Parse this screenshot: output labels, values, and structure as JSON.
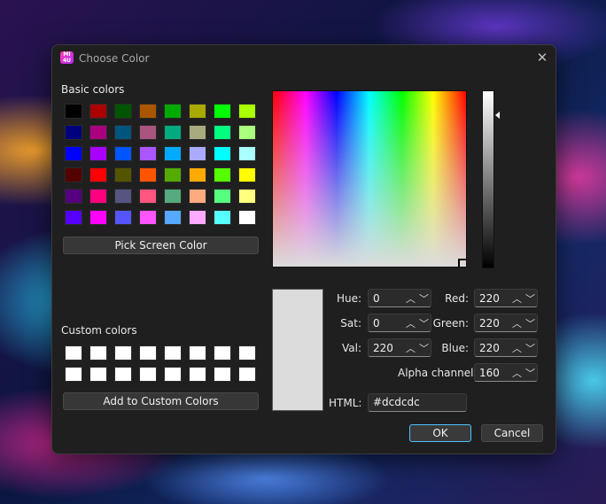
{
  "window": {
    "title": "Choose Color",
    "app_icon_text": "MICA\n4U"
  },
  "basic": {
    "label": "Basic colors",
    "swatches": [
      "#000000",
      "#aa0000",
      "#005500",
      "#aa5500",
      "#00aa00",
      "#aaaa00",
      "#00ff00",
      "#aaff00",
      "#00007f",
      "#aa007f",
      "#00557f",
      "#aa557f",
      "#00aa7f",
      "#aaaa7f",
      "#00ff7f",
      "#aaff7f",
      "#0000ff",
      "#aa00ff",
      "#0055ff",
      "#aa55ff",
      "#00aaff",
      "#aaaaff",
      "#00ffff",
      "#aaffff",
      "#550000",
      "#ff0000",
      "#555500",
      "#ff5500",
      "#55aa00",
      "#ffaa00",
      "#55ff00",
      "#ffff00",
      "#55007f",
      "#ff007f",
      "#55557f",
      "#ff557f",
      "#55aa7f",
      "#ffaa7f",
      "#55ff7f",
      "#ffff7f",
      "#5500ff",
      "#ff00ff",
      "#5555ff",
      "#ff55ff",
      "#55aaff",
      "#ffaaff",
      "#55ffff",
      "#ffffff"
    ]
  },
  "pick_button": "Pick Screen Color",
  "custom": {
    "label": "Custom colors",
    "swatches": [
      "#ffffff",
      "#ffffff",
      "#ffffff",
      "#ffffff",
      "#ffffff",
      "#ffffff",
      "#ffffff",
      "#ffffff",
      "#ffffff",
      "#ffffff",
      "#ffffff",
      "#ffffff",
      "#ffffff",
      "#ffffff",
      "#ffffff",
      "#ffffff"
    ]
  },
  "add_button": "Add to Custom Colors",
  "fields": {
    "hue": {
      "label": "Hue:",
      "value": "0"
    },
    "sat": {
      "label": "Sat:",
      "value": "0"
    },
    "val": {
      "label": "Val:",
      "value": "220"
    },
    "red": {
      "label": "Red:",
      "value": "220"
    },
    "green": {
      "label": "Green:",
      "value": "220"
    },
    "blue": {
      "label": "Blue:",
      "value": "220"
    },
    "alpha": {
      "label": "Alpha channel:",
      "value": "160"
    },
    "html": {
      "label": "HTML:",
      "value": "#dcdcdc"
    }
  },
  "spinner_icons": {
    "up": "chevron-up",
    "down": "chevron-down"
  },
  "current_color": "#dcdcdc",
  "ok": "OK",
  "cancel": "Cancel"
}
